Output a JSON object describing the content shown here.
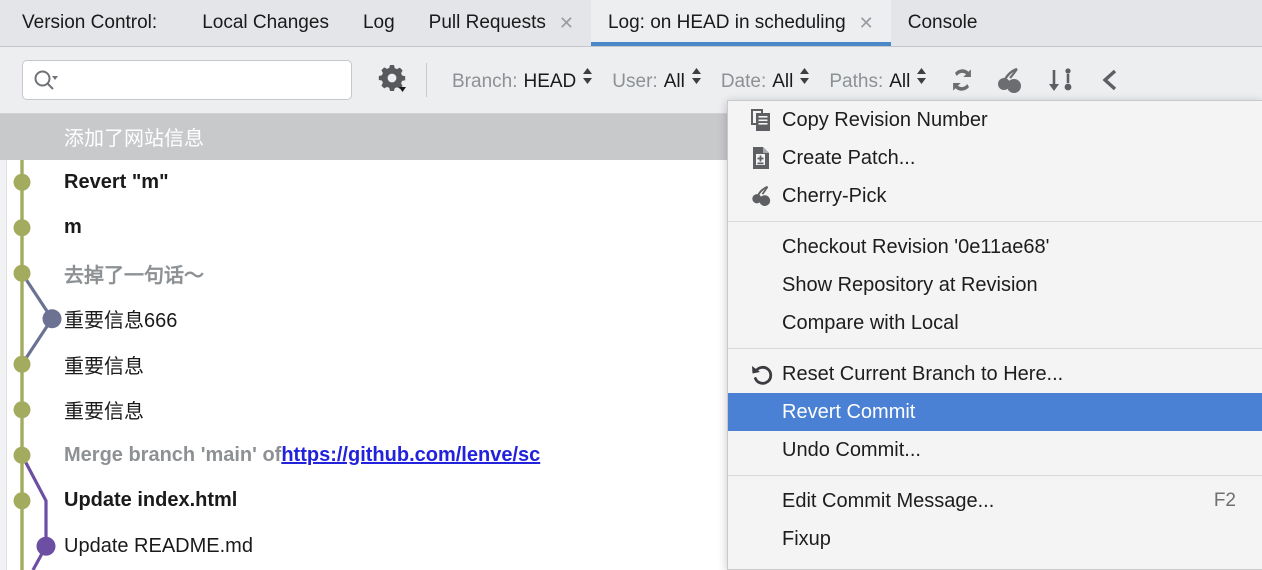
{
  "tabbar": {
    "vc_label": "Version Control:",
    "tabs": [
      {
        "label": "Local Changes",
        "closable": false,
        "active": false
      },
      {
        "label": "Log",
        "closable": false,
        "active": false
      },
      {
        "label": "Pull Requests",
        "closable": true,
        "active": false
      },
      {
        "label": "Log: on HEAD in scheduling",
        "closable": true,
        "active": true
      },
      {
        "label": "Console",
        "closable": false,
        "active": false
      }
    ],
    "close_glyph": "✕"
  },
  "toolbar": {
    "search": {
      "value": "",
      "placeholder": "",
      "icon": "search-icon"
    },
    "gear": {
      "icon": "gear-icon"
    },
    "filters": [
      {
        "name": "Branch:",
        "value": "HEAD"
      },
      {
        "name": "User:",
        "value": "All"
      },
      {
        "name": "Date:",
        "value": "All"
      },
      {
        "name": "Paths:",
        "value": "All"
      }
    ],
    "icons": [
      {
        "name": "refresh-icon"
      },
      {
        "name": "cherry-pick-icon"
      },
      {
        "name": "go-to-hash-icon"
      },
      {
        "name": "collapse-icon"
      }
    ]
  },
  "commits": [
    {
      "subject": "添加了网站信息",
      "style": "selected",
      "selected": true
    },
    {
      "subject": "Revert \"m\"",
      "style": "bold",
      "selected": false
    },
    {
      "subject": "m",
      "style": "bold",
      "selected": false
    },
    {
      "subject": "去掉了一句话～",
      "style": "muted",
      "selected": false
    },
    {
      "subject": "重要信息666",
      "style": "plain",
      "selected": false
    },
    {
      "subject": "重要信息",
      "style": "plain",
      "selected": false
    },
    {
      "subject": "重要信息",
      "style": "plain",
      "selected": false
    },
    {
      "subject": "Merge branch 'main' of ",
      "link": "https://github.com/lenve/sc",
      "style": "muted",
      "selected": false
    },
    {
      "subject": "Update index.html",
      "style": "bold",
      "selected": false
    },
    {
      "subject": "Update README.md",
      "style": "plain",
      "selected": false
    }
  ],
  "graph": {
    "main_color": "#a3ab5e",
    "branch_color": "#6b7292",
    "purple_color": "#6c4fa3"
  },
  "context_menu": {
    "groups": [
      {
        "items": [
          {
            "label": "Copy Revision Number",
            "icon": "copy-icon",
            "shortcut": "",
            "highlight": false
          },
          {
            "label": "Create Patch...",
            "icon": "create-patch-icon",
            "shortcut": "",
            "highlight": false
          },
          {
            "label": "Cherry-Pick",
            "icon": "cherry-pick-icon",
            "shortcut": "",
            "highlight": false
          }
        ]
      },
      {
        "items": [
          {
            "label": "Checkout Revision '0e11ae68'",
            "icon": "",
            "shortcut": "",
            "highlight": false
          },
          {
            "label": "Show Repository at Revision",
            "icon": "",
            "shortcut": "",
            "highlight": false
          },
          {
            "label": "Compare with Local",
            "icon": "",
            "shortcut": "",
            "highlight": false
          }
        ]
      },
      {
        "items": [
          {
            "label": "Reset Current Branch to Here...",
            "icon": "reset-icon",
            "shortcut": "",
            "highlight": false
          },
          {
            "label": "Revert Commit",
            "icon": "",
            "shortcut": "",
            "highlight": true
          },
          {
            "label": "Undo Commit...",
            "icon": "",
            "shortcut": "",
            "highlight": false
          }
        ]
      },
      {
        "items": [
          {
            "label": "Edit Commit Message...",
            "icon": "",
            "shortcut": "F2",
            "highlight": false
          },
          {
            "label": "Fixup",
            "icon": "",
            "shortcut": "",
            "highlight": false
          }
        ]
      }
    ]
  },
  "colors": {
    "accent": "#4a81d4",
    "tab_underline": "#4a88c7",
    "selection_gray": "#c8c9cb",
    "link": "#2222dd"
  }
}
